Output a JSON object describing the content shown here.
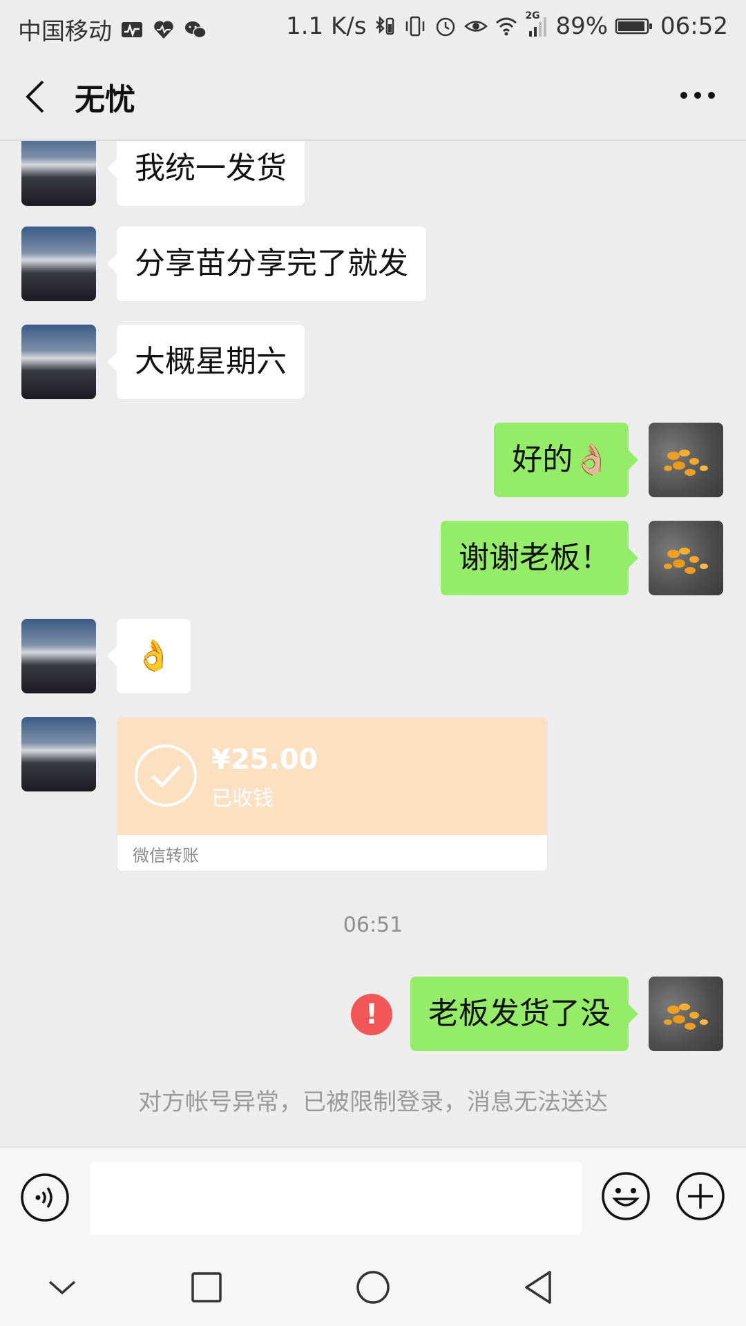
{
  "status_bar": {
    "carrier": "中国移动",
    "net_speed": "1.1 K/s",
    "network_type": "2G",
    "battery": "89%",
    "time": "06:52"
  },
  "header": {
    "title": "无忧"
  },
  "messages": [
    {
      "side": "in",
      "text": "我统一发货"
    },
    {
      "side": "in",
      "text": "分享苗分享完了就发"
    },
    {
      "side": "in",
      "text": "大概星期六"
    },
    {
      "side": "out",
      "text": "好的",
      "emoji": "👌🏼"
    },
    {
      "side": "out",
      "text": "谢谢老板！"
    },
    {
      "side": "in",
      "text": "",
      "emoji": "👌"
    },
    {
      "side": "out",
      "text": "老板发货了没",
      "failed": true
    }
  ],
  "transfer": {
    "amount": "¥25.00",
    "status": "已收钱",
    "label": "微信转账"
  },
  "timestamp": "06:51",
  "system_note": "对方帐号异常，已被限制登录，消息无法送达",
  "error_glyph": "!",
  "colors": {
    "outgoing_bubble": "#95ec69",
    "incoming_bubble": "#ffffff",
    "transfer_card": "#fbe0c2",
    "error": "#f25656",
    "background": "#ededed"
  }
}
